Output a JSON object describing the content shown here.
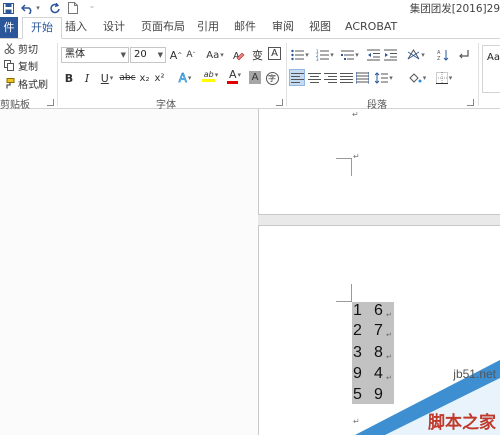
{
  "title_bar": {
    "doc_title": "集团团发[2016]29",
    "save_icon": "save-icon",
    "undo_icon": "undo-icon",
    "redo_icon": "redo-icon",
    "new_doc_icon": "new-document-icon",
    "customize_icon": "customize-qa-icon"
  },
  "tabs": {
    "file": "件",
    "items": [
      "开始",
      "插入",
      "设计",
      "页面布局",
      "引用",
      "邮件",
      "审阅",
      "视图",
      "ACROBAT"
    ],
    "active": "开始"
  },
  "clipboard": {
    "cut": "剪切",
    "copy": "复制",
    "format_painter": "格式刷",
    "group_label": "剪贴板"
  },
  "font": {
    "name": "黑体",
    "size": "20",
    "grow": "A",
    "shrink": "A",
    "change_case": "Aa",
    "clear_format_icon": "clear-formatting-icon",
    "phonetic": "变",
    "char_border": "A",
    "bold": "B",
    "italic": "I",
    "underline": "U",
    "strike": "abc",
    "sub": "x₂",
    "sup": "x²",
    "text_effect": "A",
    "highlight": "ab",
    "font_color": "A",
    "char_shade": "A",
    "enclose": "字",
    "group_label": "字体"
  },
  "paragraph": {
    "group_label": "段落"
  },
  "styles": {
    "preview": "AaB"
  },
  "document": {
    "numbers": [
      [
        "1",
        "6"
      ],
      [
        "2",
        "7"
      ],
      [
        "3",
        "8"
      ],
      [
        "9",
        "4"
      ],
      [
        "5",
        "9"
      ]
    ]
  },
  "watermark": {
    "site": "jb51.net",
    "name": "脚本之家"
  },
  "colors": {
    "accent": "#2b579a",
    "highlight_yellow": "#ffff00",
    "font_red": "#e00000",
    "selection": "#c2c2c2",
    "watermark_blue": "#3d8fd1",
    "watermark_red": "#c0392b"
  }
}
